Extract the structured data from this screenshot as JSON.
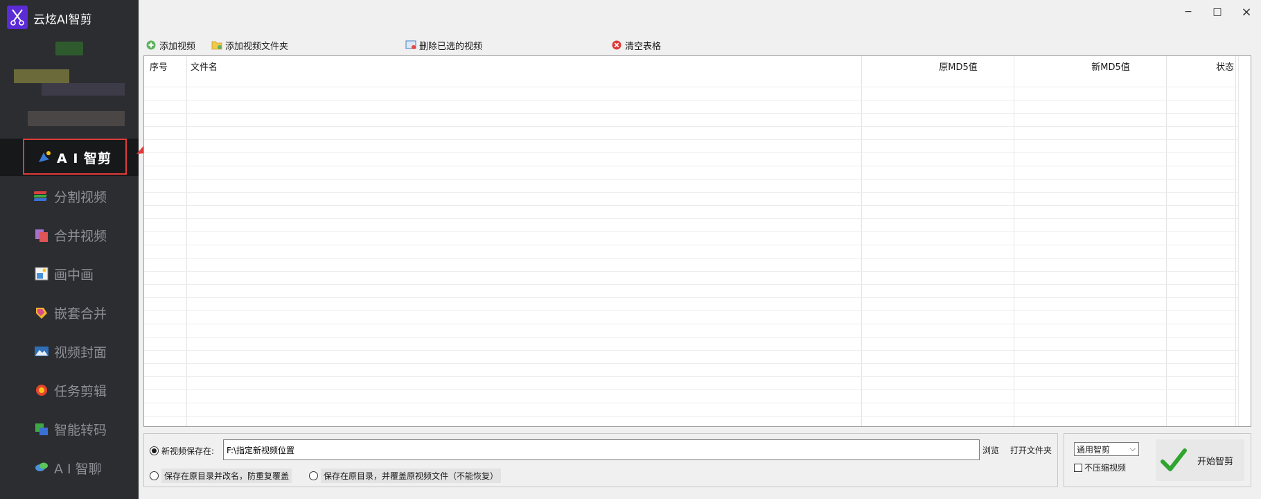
{
  "app": {
    "title": "云炫AI智剪",
    "logo_icon": "scissors-icon",
    "accent": "#5b2bd6"
  },
  "window_controls": {
    "minimize": "−",
    "maximize": "□",
    "close": "×"
  },
  "sidebar": {
    "items": [
      {
        "label": "A I 智剪",
        "icon": "ai-edit-icon",
        "active": true
      },
      {
        "label": "分割视频",
        "icon": "split-video-icon",
        "active": false
      },
      {
        "label": "合并视频",
        "icon": "merge-video-icon",
        "active": false
      },
      {
        "label": "画中画",
        "icon": "picture-in-picture-icon",
        "active": false
      },
      {
        "label": "嵌套合并",
        "icon": "nested-merge-icon",
        "active": false
      },
      {
        "label": "视频封面",
        "icon": "video-cover-icon",
        "active": false
      },
      {
        "label": "任务剪辑",
        "icon": "task-edit-icon",
        "active": false
      },
      {
        "label": "智能转码",
        "icon": "smart-transcode-icon",
        "active": false
      },
      {
        "label": "A I 智聊",
        "icon": "ai-chat-icon",
        "active": false
      }
    ]
  },
  "toolbar": {
    "add_video": "添加视频",
    "add_folder": "添加视频文件夹",
    "delete_selected": "删除已选的视频",
    "clear_table": "清空表格"
  },
  "table": {
    "columns": [
      "序号",
      "文件名",
      "原MD5值",
      "新MD5值",
      "状态"
    ],
    "rows": []
  },
  "save": {
    "option_new_label": "新视频保存在:",
    "path_value": "F:\\指定新视频位置",
    "browse": "浏览",
    "open_folder": "打开文件夹",
    "option_rename": "保存在原目录并改名，防重复覆盖",
    "option_overwrite": "保存在原目录，并覆盖原视频文件（不能恢复）",
    "selected": "new"
  },
  "action": {
    "mode_value": "通用智剪",
    "no_compress_label": "不压缩视频",
    "no_compress_checked": false,
    "start_label": "开始智剪"
  },
  "colors": {
    "sidebar_bg": "#2b2d31",
    "active_bg": "#17181a",
    "highlight_border": "#e03a3a",
    "check_green": "#2fa52f"
  }
}
